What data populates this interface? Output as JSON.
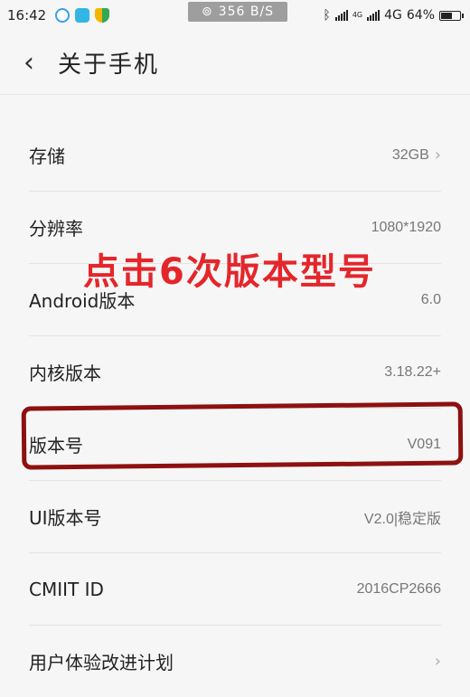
{
  "status_bar": {
    "time": "16:42",
    "net_speed": "356 B/S",
    "network_type": "4G",
    "battery_percent": "64%",
    "battery_level": 0.64,
    "small_4g_label": "4G"
  },
  "header": {
    "title": "关于手机"
  },
  "settings": [
    {
      "label": "存储",
      "value": "32GB",
      "chevron": true
    },
    {
      "label": "分辨率",
      "value": "1080*1920",
      "chevron": false
    },
    {
      "label": "Android版本",
      "value": "6.0",
      "chevron": false
    },
    {
      "label": "内核版本",
      "value": "3.18.22+",
      "chevron": false
    },
    {
      "label": "版本号",
      "value": "V091",
      "chevron": false
    },
    {
      "label": "UI版本号",
      "value": "V2.0|稳定版",
      "chevron": false
    },
    {
      "label": "CMIIT ID",
      "value": "2016CP2666",
      "chevron": false
    },
    {
      "label": "用户体验改进计划",
      "value": "",
      "chevron": true
    }
  ],
  "annotation": {
    "text": "点击6次版本型号",
    "color": "#e4262b",
    "box_color": "#8e1010"
  }
}
